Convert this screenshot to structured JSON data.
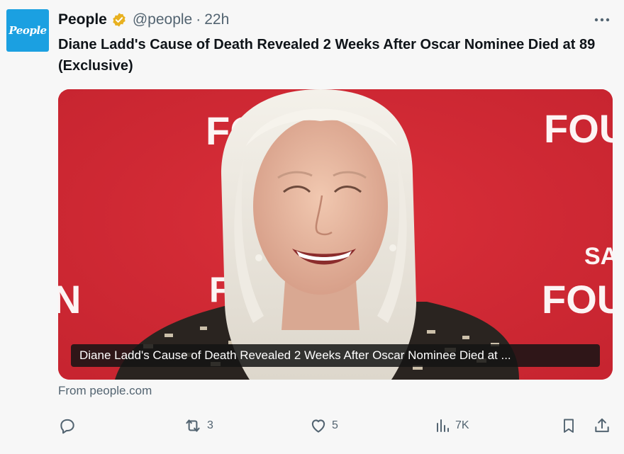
{
  "post": {
    "avatar_text": "People",
    "author_name": "People",
    "author_handle": "@people",
    "separator": "·",
    "timestamp": "22h",
    "headline": "Diane Ladd's Cause of Death Revealed 2 Weeks After Oscar Nominee Died at 89 (Exclusive)",
    "more_label": "···"
  },
  "card": {
    "image_caption": "Diane Ladd's Cause of Death Revealed 2 Weeks After Oscar Nominee Died at ...",
    "backdrop_texts": [
      "FOUN",
      "FO",
      "N",
      "FOUN",
      "SA",
      "FOUN",
      "FO",
      "N"
    ],
    "source": "From people.com"
  },
  "actions": {
    "reply_count": "",
    "repost_count": "3",
    "like_count": "5",
    "views_count": "7K"
  },
  "colors": {
    "verified_badge": "#e8b120",
    "backdrop_red": "#d62b36",
    "muted_text": "#536471"
  },
  "icons": [
    "verified-badge-icon",
    "more-icon",
    "reply-icon",
    "repost-icon",
    "like-icon",
    "views-icon",
    "bookmark-icon",
    "share-icon"
  ]
}
